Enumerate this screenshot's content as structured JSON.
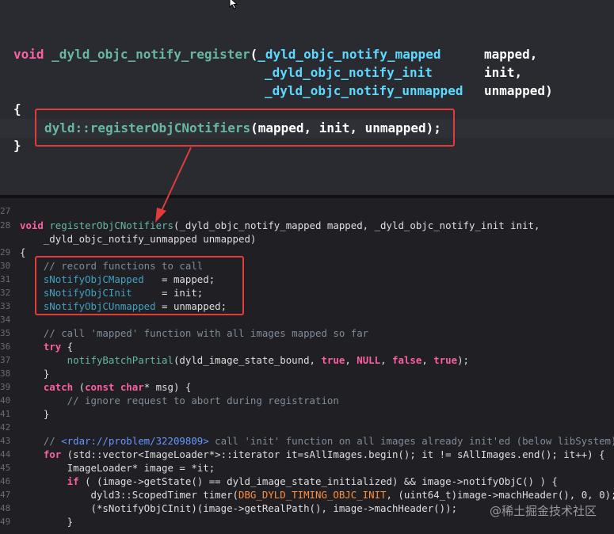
{
  "top": {
    "line1": {
      "kw": "void",
      "fn": "_dyld_objc_notify_register",
      "paren": "(",
      "type": "_dyld_objc_notify_mapped",
      "param": "mapped,"
    },
    "line2": {
      "type": "_dyld_objc_notify_init",
      "param": "init,"
    },
    "line3": {
      "type": "_dyld_objc_notify_unmapped",
      "param": "unmapped)"
    },
    "line4": "{",
    "line5": {
      "ns": "dyld::",
      "fn": "registerObjCNotifiers",
      "args": "(mapped, init, unmapped);"
    },
    "line6": "}"
  },
  "bottom": {
    "partial_line_number": "27",
    "lines": [
      {
        "n": "28",
        "kw": "void",
        "fn": "registerObjCNotifiers",
        "rest": "(_dyld_objc_notify_mapped mapped, _dyld_objc_notify_init init,"
      },
      {
        "n": "",
        "rest": "    _dyld_objc_notify_unmapped unmapped)"
      },
      {
        "n": "29",
        "rest": "{"
      },
      {
        "n": "30",
        "cm": "    // record functions to call"
      },
      {
        "n": "31",
        "var": "    sNotifyObjCMapped",
        "rest": "   = mapped;"
      },
      {
        "n": "32",
        "var": "    sNotifyObjCInit",
        "rest": "     = init;"
      },
      {
        "n": "33",
        "var": "    sNotifyObjCUnmapped",
        "rest": " = unmapped;"
      },
      {
        "n": "34",
        "rest": ""
      },
      {
        "n": "35",
        "cm": "    // call 'mapped' function with all images mapped so far"
      },
      {
        "n": "36",
        "kw": "    try",
        "rest": " {"
      },
      {
        "n": "37",
        "fn": "        notifyBatchPartial",
        "rest": "(dyld_image_state_bound, ",
        "kw2": "true",
        "rest2": ", ",
        "kw3": "NULL",
        "rest3": ", ",
        "kw4": "false",
        "rest4": ", ",
        "kw5": "true",
        "rest5": ");"
      },
      {
        "n": "38",
        "rest": "    }"
      },
      {
        "n": "39",
        "kw": "    catch",
        "rest": " (",
        "kw2": "const",
        "rest2": " ",
        "kw3": "char",
        "rest3": "* msg) {"
      },
      {
        "n": "40",
        "cm": "        // ignore request to abort during registration"
      },
      {
        "n": "41",
        "rest": "    }"
      },
      {
        "n": "42",
        "rest": ""
      },
      {
        "n": "43",
        "cm": "    // ",
        "link": "<rdar://problem/32209809>",
        "cm2": " call 'init' function on all images already init'ed (below libSystem)"
      },
      {
        "n": "44",
        "kw": "    for",
        "rest": " (std::vector<ImageLoader*>::iterator it=sAllImages.begin(); it != sAllImages.end(); it++) {"
      },
      {
        "n": "45",
        "rest": "        ImageLoader* image = *it;"
      },
      {
        "n": "46",
        "kw": "        if",
        "rest": " ( (image->getState() == dyld_image_state_initialized) && image->notifyObjC() ) {"
      },
      {
        "n": "47",
        "rest": "            dyld3::ScopedTimer timer(",
        "macro": "DBG_DYLD_TIMING_OBJC_INIT",
        "rest2": ", (uint64_t)image->machHeader(), 0, 0);"
      },
      {
        "n": "48",
        "rest": "            (*sNotifyObjCInit)(image->getRealPath(), image->machHeader());"
      },
      {
        "n": "49",
        "rest": "        }"
      }
    ]
  },
  "watermark": "@稀土掘金技术社区",
  "colors": {
    "highlight_box": "#e23b3b",
    "arrow": "#e23b3b"
  }
}
